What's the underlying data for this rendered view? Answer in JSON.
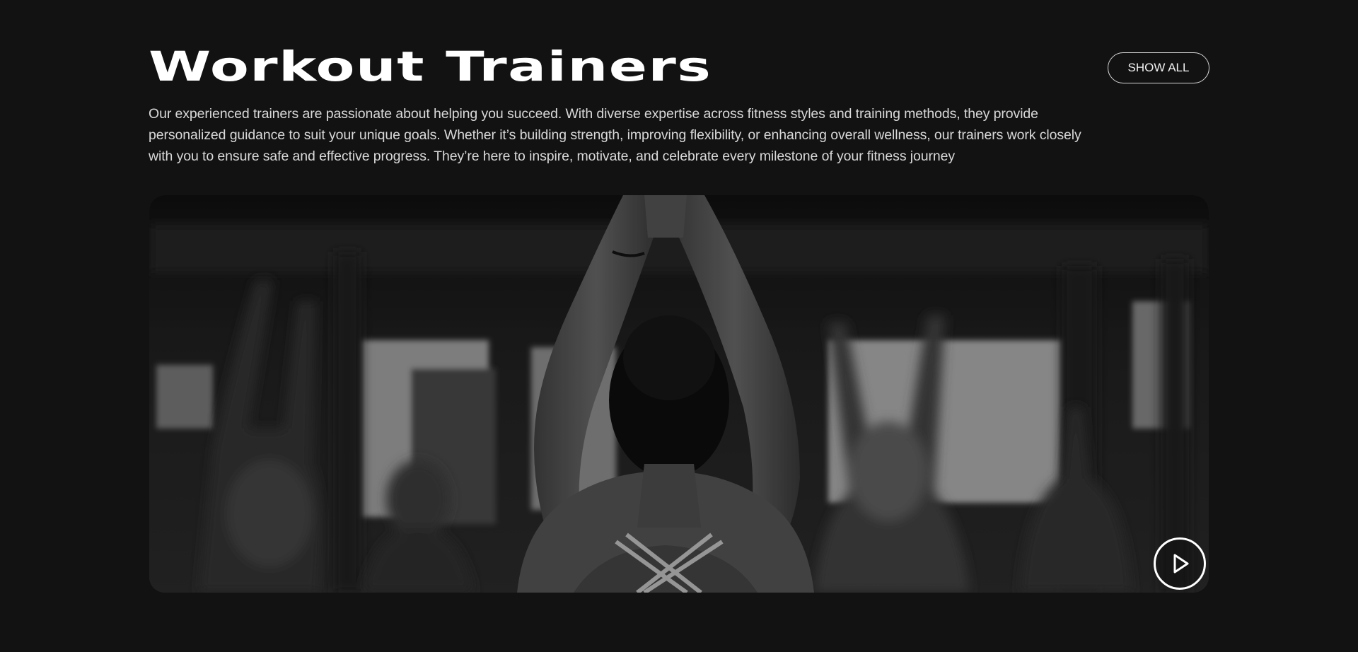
{
  "section": {
    "title": "Workout Trainers",
    "show_all_label": "SHOW ALL",
    "description": "Our experienced trainers are passionate about helping you succeed. With diverse expertise across fitness styles and training methods, they provide personalized guidance to suit your unique goals. Whether it’s building strength, improving flexibility, or enhancing overall wellness, our trainers work closely with you to ensure safe and effective progress. They’re here to inspire, motivate, and celebrate every milestone of your fitness journey"
  },
  "video": {
    "thumbnail_icon": "yoga-class-photo",
    "play_icon": "play-icon"
  },
  "colors": {
    "background": "#121212",
    "text": "#ffffff",
    "muted_text": "#d9d9d9",
    "button_border": "#d6d6d6"
  }
}
